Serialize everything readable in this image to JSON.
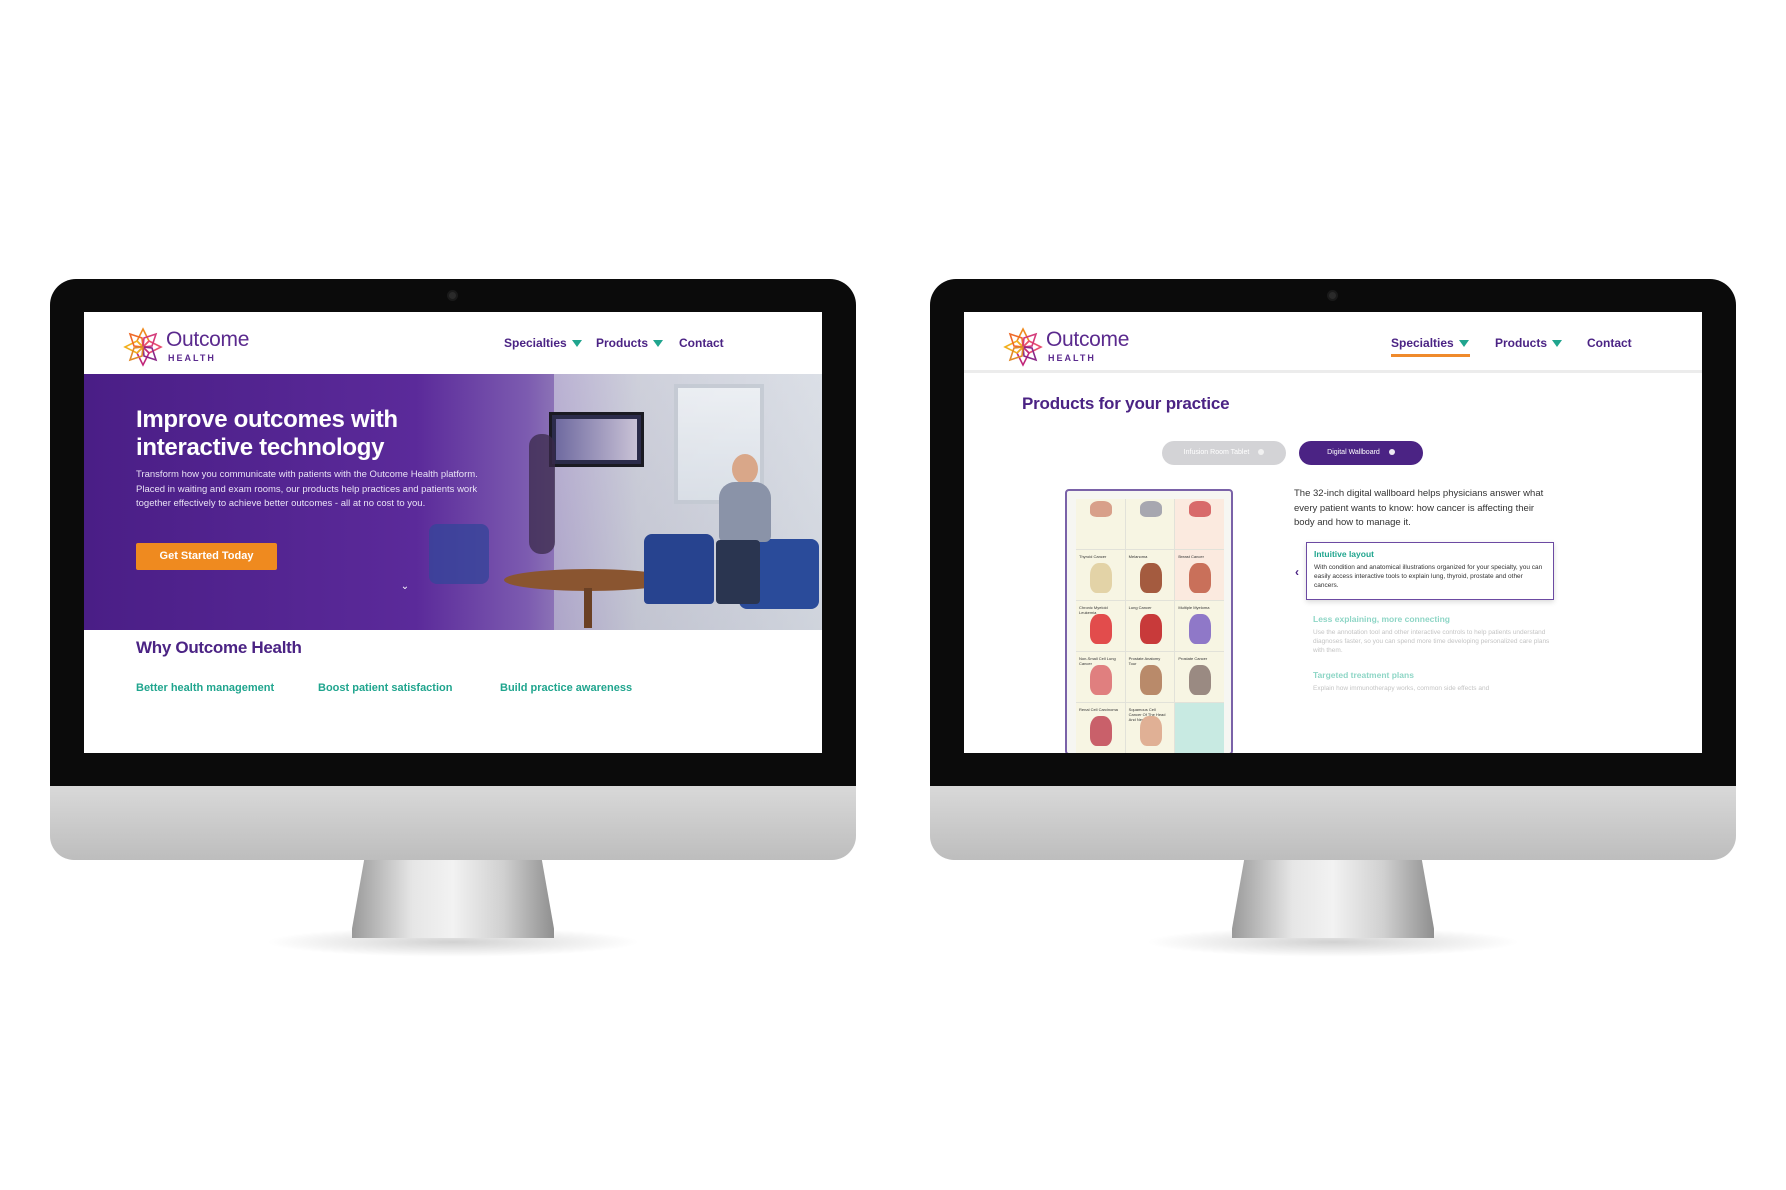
{
  "brand": {
    "name": "Outcome",
    "sub": "HEALTH",
    "colors": {
      "purple": "#4b2384",
      "teal": "#20a58e",
      "orange": "#ef8a1f"
    }
  },
  "left_screen": {
    "nav": {
      "specialties": "Specialties",
      "products": "Products",
      "contact": "Contact"
    },
    "hero": {
      "title": "Improve outcomes with interactive technology",
      "body": "Transform how you communicate with patients with the Outcome Health platform. Placed in waiting and exam rooms, our products help practices and patients work together effectively to achieve better outcomes - all at no cost to you.",
      "cta": "Get Started Today",
      "scroll_icon": "chevron-down-icon"
    },
    "why_title": "Why Outcome Health",
    "benefits": [
      "Better health management",
      "Boost patient satisfaction",
      "Build practice awareness"
    ]
  },
  "right_screen": {
    "nav": {
      "specialties": "Specialties",
      "products": "Products",
      "contact": "Contact",
      "active": "Specialties"
    },
    "title": "Products for your practice",
    "tabs": [
      {
        "label": "Infusion Room Tablet",
        "active": false
      },
      {
        "label": "Digital Wallboard",
        "active": true
      }
    ],
    "wallboard_cells": [
      {
        "label": "",
        "tone": "default",
        "color": "#d8a08a"
      },
      {
        "label": "",
        "tone": "default",
        "color": "#a7a7b0"
      },
      {
        "label": "",
        "tone": "peach",
        "color": "#d86a6a"
      },
      {
        "label": "Thyroid Cancer",
        "tone": "default",
        "color": "#e3d3a7"
      },
      {
        "label": "Melanoma",
        "tone": "default",
        "color": "#a45b3f"
      },
      {
        "label": "Breast Cancer",
        "tone": "peach",
        "color": "#c9705a"
      },
      {
        "label": "Chronic Myeloid Leukemia",
        "tone": "default",
        "color": "#e24c4c"
      },
      {
        "label": "Lung Cancer",
        "tone": "default",
        "color": "#c83a3a"
      },
      {
        "label": "Multiple Myeloma",
        "tone": "default",
        "color": "#8f78c8"
      },
      {
        "label": "Non-Small Cell Lung Cancer",
        "tone": "default",
        "color": "#e07f7f"
      },
      {
        "label": "Prostate Anatomy Tour",
        "tone": "default",
        "color": "#b98a6a"
      },
      {
        "label": "Prostate Cancer",
        "tone": "default",
        "color": "#9a8a82"
      },
      {
        "label": "Renal Cell Carcinoma",
        "tone": "default",
        "color": "#c9606a"
      },
      {
        "label": "Squamous Cell Cancer Of The Head And Neck",
        "tone": "default",
        "color": "#e0b095"
      },
      {
        "label": "",
        "tone": "teal",
        "color": "#c8eae2"
      }
    ],
    "description": "The 32-inch digital wallboard helps physicians answer what every patient wants to know: how cancer is affecting their body and how to manage it.",
    "features": [
      {
        "title": "Intuitive layout",
        "body": "With condition and anatomical illustrations organized for your specialty, you can easily access interactive tools to explain lung, thyroid, prostate and other cancers."
      },
      {
        "title": "Less explaining, more connecting",
        "body": "Use the annotation tool and other interactive controls to help patients understand diagnoses faster, so you can spend more time developing personalized care plans with them."
      },
      {
        "title": "Targeted treatment plans",
        "body": "Explain how immunotherapy works, common side effects and"
      }
    ],
    "prev_icon": "chevron-left-icon"
  }
}
